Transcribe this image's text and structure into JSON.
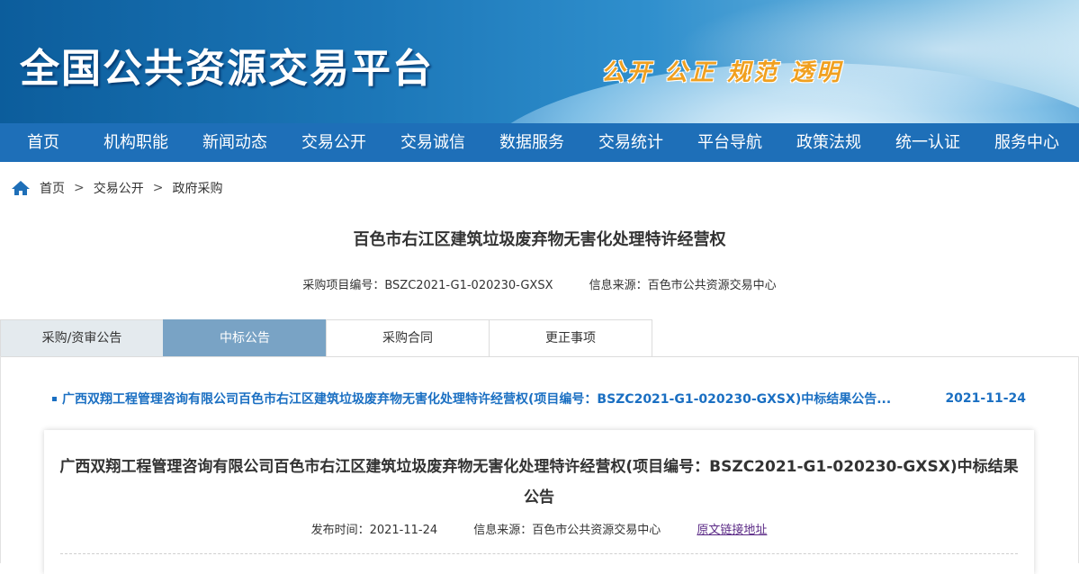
{
  "header": {
    "site_title": "全国公共资源交易平台",
    "slogan": "公开 公正 规范 透明"
  },
  "nav": {
    "items": [
      "首页",
      "机构职能",
      "新闻动态",
      "交易公开",
      "交易诚信",
      "数据服务",
      "交易统计",
      "平台导航",
      "政策法规",
      "统一认证",
      "服务中心"
    ]
  },
  "breadcrumb": {
    "items": [
      "首页",
      "交易公开",
      "政府采购"
    ],
    "separator": ">"
  },
  "project": {
    "title": "百色市右江区建筑垃圾废弃物无害化处理特许经营权",
    "code_text": "采购项目编号：BSZC2021-G1-020230-GXSX",
    "source_text": "信息来源：百色市公共资源交易中心"
  },
  "tabs": {
    "items": [
      "采购/资审公告",
      "中标公告",
      "采购合同",
      "更正事项"
    ],
    "active": "中标公告"
  },
  "notice_list": {
    "items": [
      {
        "title": "广西双翔工程管理咨询有限公司百色市右江区建筑垃圾废弃物无害化处理特许经营权(项目编号：BSZC2021-G1-020230-GXSX)中标结果公告...",
        "date": "2021-11-24"
      }
    ]
  },
  "notice_detail": {
    "title": "广西双翔工程管理咨询有限公司百色市右江区建筑垃圾废弃物无害化处理特许经营权(项目编号：BSZC2021-G1-020230-GXSX)中标结果公告",
    "publish_time": "发布时间：2021-11-24",
    "source": "信息来源：百色市公共资源交易中心",
    "original_link": "原文链接地址"
  },
  "colors": {
    "nav_bg": "#1e6fb8",
    "active_tab": "#79a3c5",
    "link": "#1a6fc2",
    "slogan": "#f0a020"
  }
}
